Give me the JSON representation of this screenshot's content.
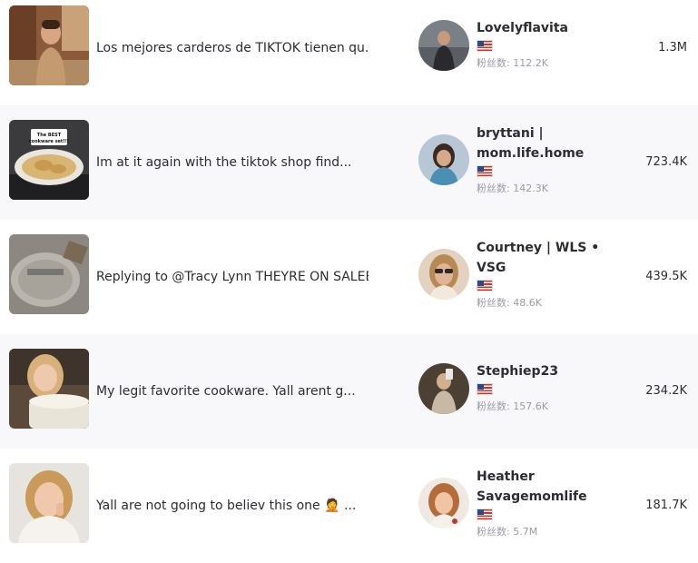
{
  "fans_label": "粉丝数:",
  "rows": [
    {
      "title": "Los mejores carderos de TIKTOK tienen qu...",
      "creator": "Lovelyflavita",
      "country": "US",
      "fans": "112.2K",
      "views": "1.3M"
    },
    {
      "title": "Im at it again with the tiktok shop find...",
      "creator": "bryttani | mom.life.home",
      "country": "US",
      "fans": "142.3K",
      "views": "723.4K",
      "thumb_caption": "The BEST cookware set!!!"
    },
    {
      "title": "Replying to @Tracy Lynn THEYRE ON SALEE...",
      "creator": "Courtney | WLS • VSG",
      "country": "US",
      "fans": "48.6K",
      "views": "439.5K"
    },
    {
      "title": "My legit favorite cookware. Yall arent g...",
      "creator": "Stephiep23",
      "country": "US",
      "fans": "157.6K",
      "views": "234.2K"
    },
    {
      "title": "Yall are not going to believ this one 🤦 ...",
      "creator": "Heather Savagemomlife",
      "country": "US",
      "fans": "5.7M",
      "views": "181.7K"
    }
  ]
}
